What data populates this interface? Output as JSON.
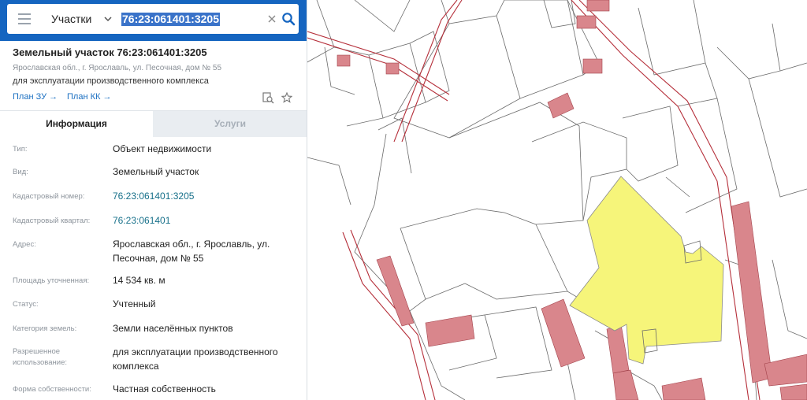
{
  "search": {
    "mode": "Участки",
    "query": "76:23:061401:3205"
  },
  "object": {
    "title": "Земельный участок 76:23:061401:3205",
    "address": "Ярославская обл., г. Ярославль, ул. Песочная, дом № 55",
    "purpose": "для эксплуатации производственного комплекса",
    "plan_zu": "План ЗУ →",
    "plan_kk": "План КК →"
  },
  "tabs": {
    "info": "Информация",
    "services": "Услуги"
  },
  "fields": {
    "type": {
      "label": "Тип:",
      "value": "Объект недвижимости"
    },
    "kind": {
      "label": "Вид:",
      "value": "Земельный участок"
    },
    "cad_num": {
      "label": "Кадастровый номер:",
      "value": "76:23:061401:3205"
    },
    "cad_block": {
      "label": "Кадастровый квартал:",
      "value": "76:23:061401"
    },
    "address": {
      "label": "Адрес:",
      "value": "Ярославская обл., г. Ярославль, ул. Песочная, дом № 55"
    },
    "area": {
      "label": "Площадь уточненная:",
      "value": "14 534 кв. м"
    },
    "status": {
      "label": "Статус:",
      "value": "Учтенный"
    },
    "category": {
      "label": "Категория земель:",
      "value": "Земли населённых пунктов"
    },
    "use": {
      "label": "Разрешенное использование:",
      "value": "для эксплуатации производственного комплекса"
    },
    "ownership": {
      "label": "Форма собственности:",
      "value": "Частная собственность"
    }
  },
  "map": {
    "colors": {
      "selected_parcel": "#f6f57a",
      "building": "#d9868c",
      "boundary": "#b52f3a",
      "parcel_line": "#666666"
    }
  }
}
